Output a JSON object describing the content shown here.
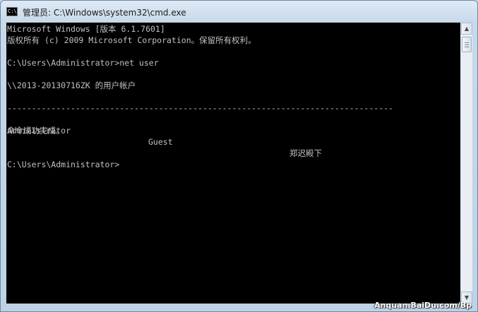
{
  "window": {
    "title": "管理员: C:\\Windows\\system32\\cmd.exe",
    "icon": "cmd-icon"
  },
  "console": {
    "lines": [
      "Microsoft Windows [版本 6.1.7601]",
      "版权所有 (c) 2009 Microsoft Corporation。保留所有权利。",
      "C:\\Users\\Administrator>net user",
      "\\\\2013-20130716ZK 的用户帐户",
      "-------------------------------------------------------------------------------",
      "命令成功完成。",
      "C:\\Users\\Administrator>"
    ],
    "accounts": [
      "Administrator",
      "Guest",
      "郑迟殿下"
    ]
  },
  "watermark": "Anquan.BaiDu.com/Bp"
}
